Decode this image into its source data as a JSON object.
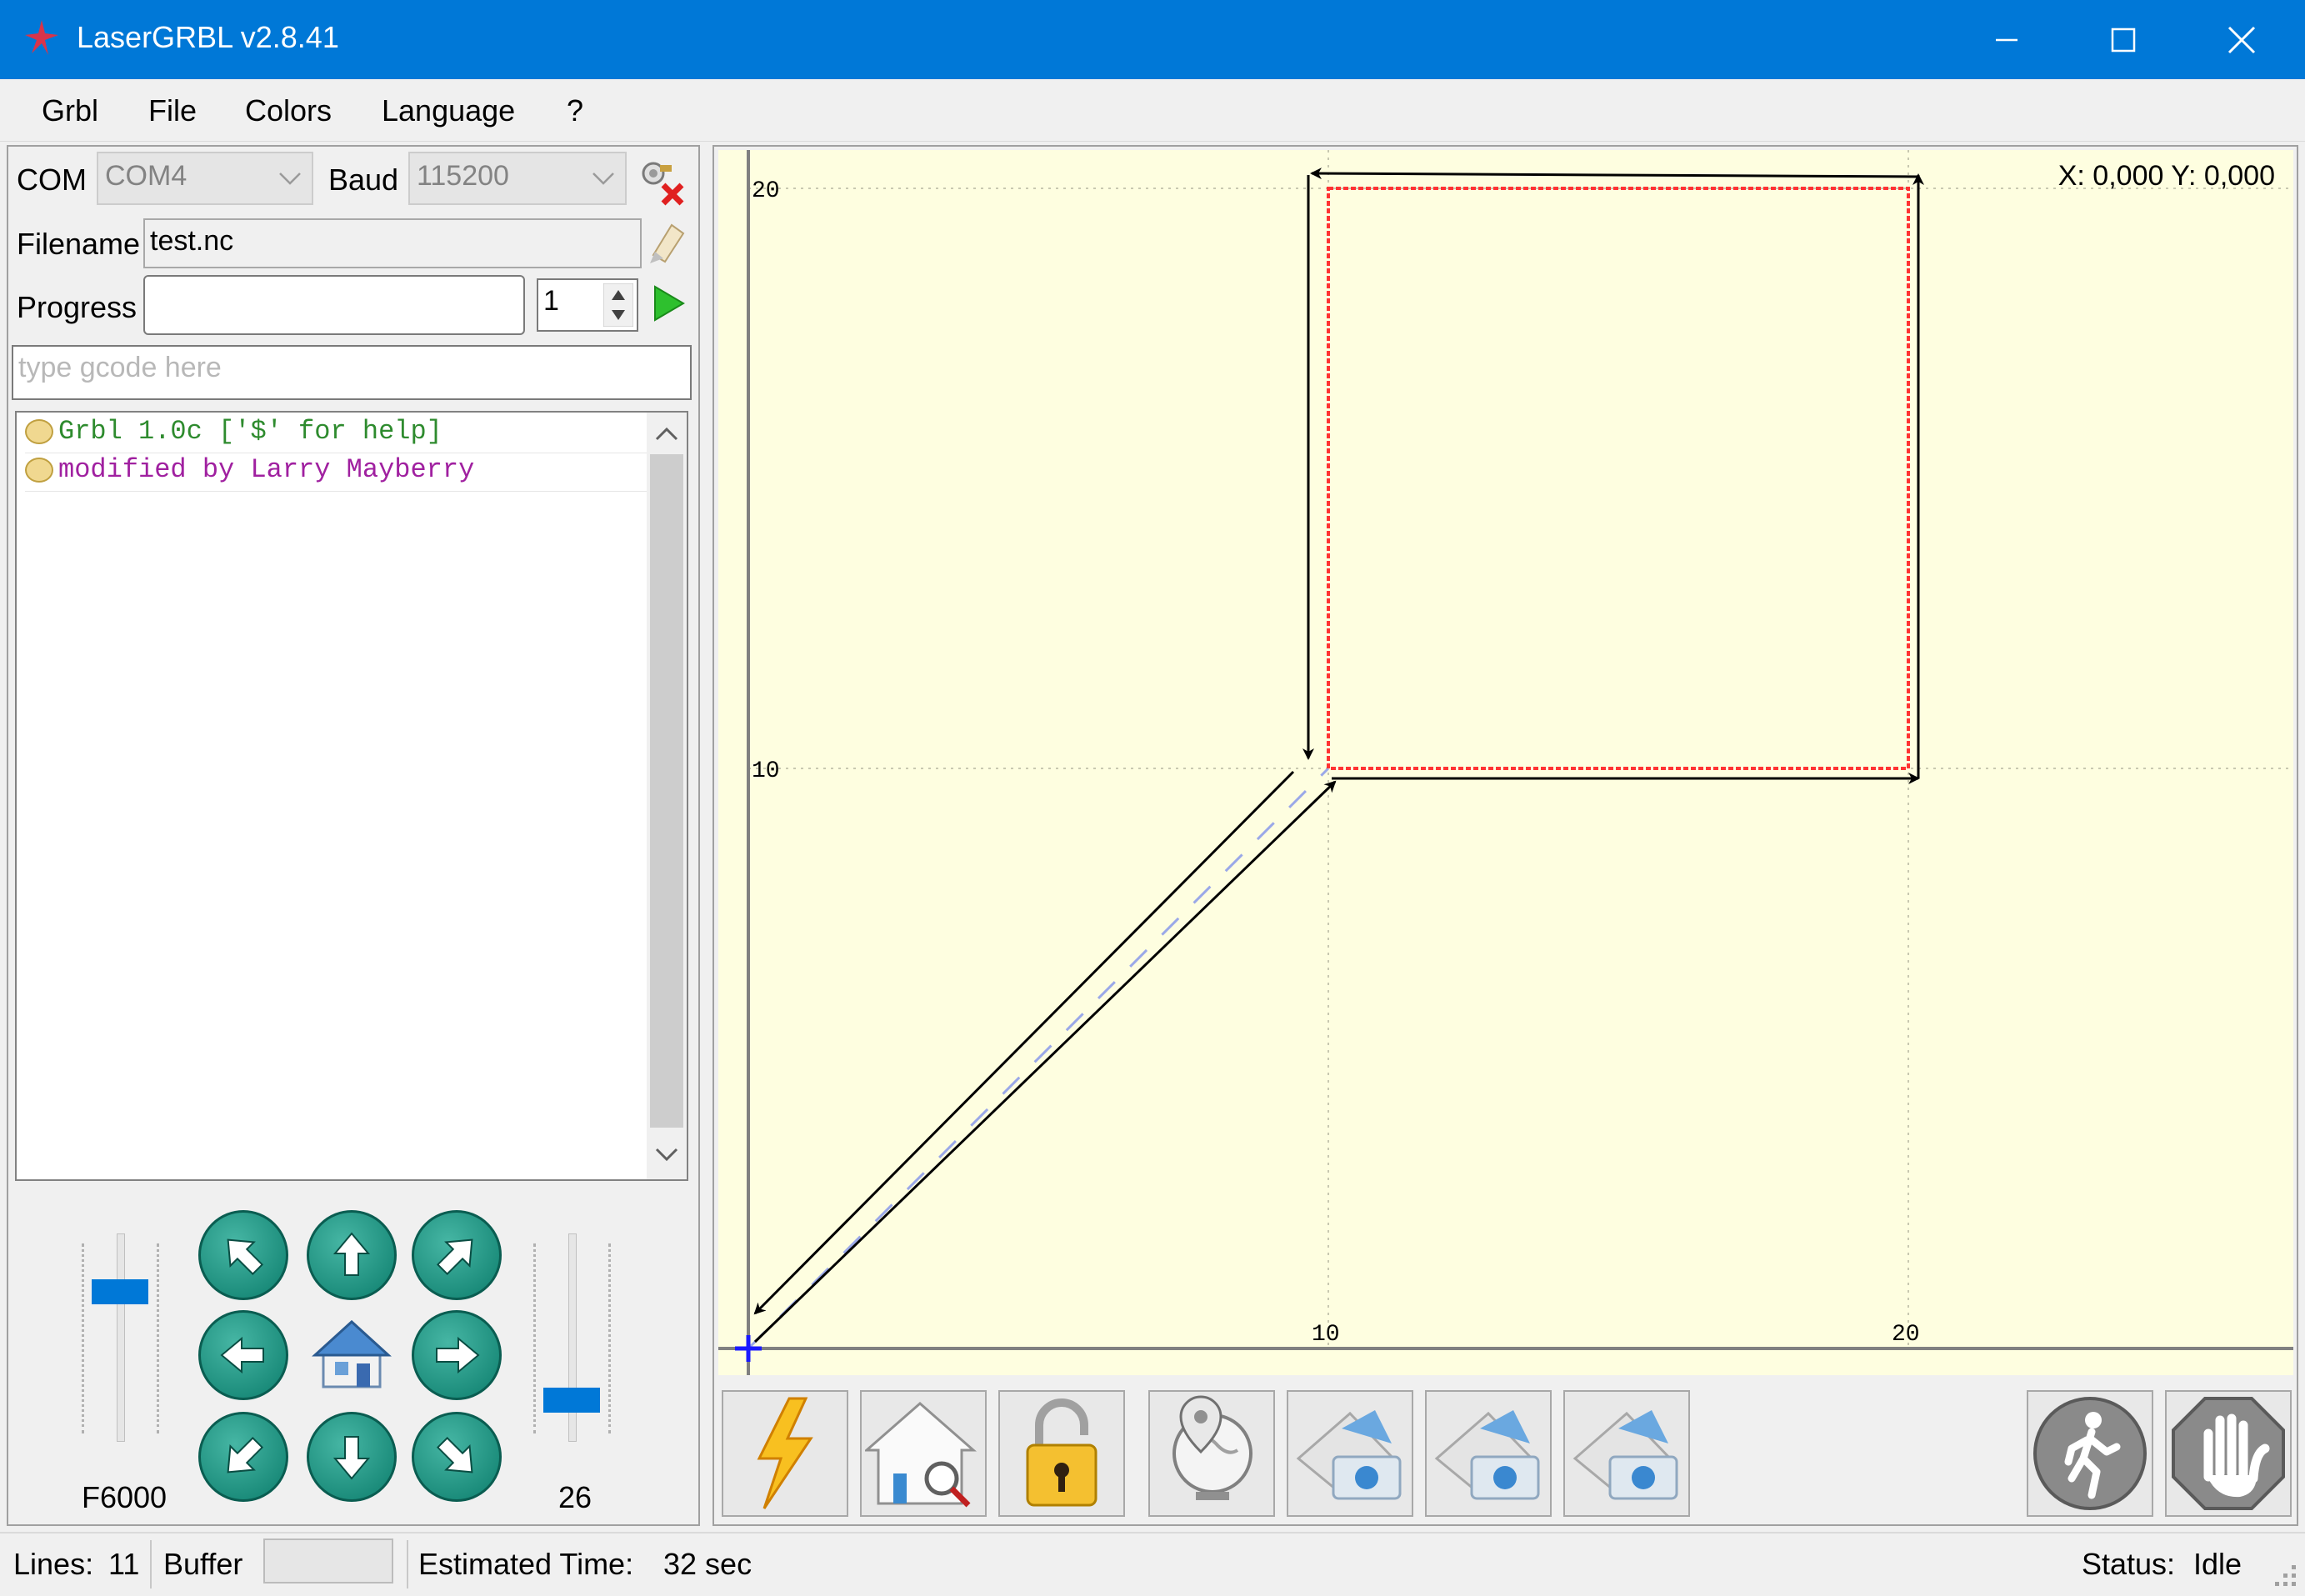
{
  "window": {
    "title": "LaserGRBL v2.8.41"
  },
  "menu": [
    "Grbl",
    "File",
    "Colors",
    "Language",
    "?"
  ],
  "connection": {
    "com_label": "COM",
    "com_value": "COM4",
    "baud_label": "Baud",
    "baud_value": "115200"
  },
  "file": {
    "filename_label": "Filename",
    "filename_value": "test.nc"
  },
  "progress": {
    "label": "Progress",
    "fraction": 0.0,
    "copies": "1"
  },
  "gcode_input": {
    "placeholder": "type gcode here"
  },
  "console": {
    "lines": [
      {
        "text": "Grbl 1.0c ['$' for help]",
        "color": "#2e8b2e"
      },
      {
        "text": "modified by Larry Mayberry",
        "color": "#a020a0"
      }
    ]
  },
  "jog": {
    "speed_label": "F6000",
    "step_label": "26",
    "speed_level": 0.75,
    "step_level": 0.15
  },
  "preview": {
    "coordinates": "X: 0,000 Y: 0,000",
    "axis_ticks": {
      "y": [
        "20",
        "10"
      ],
      "x": [
        "10",
        "20"
      ]
    },
    "background_color": "#fefee0",
    "path_color": "#ff3333"
  },
  "toolbar": {
    "icons": [
      "laser-fire-icon",
      "homing-icon",
      "unlock-icon",
      "world-origin-icon",
      "custom-button-1-icon",
      "custom-button-2-icon",
      "custom-button-3-icon",
      "resume-icon",
      "abort-icon"
    ]
  },
  "status": {
    "lines_label": "Lines:",
    "lines_value": "11",
    "buffer_label": "Buffer",
    "estimated_label": "Estimated Time:",
    "estimated_value": "32 sec",
    "status_label": "Status:",
    "status_value": "Idle"
  }
}
